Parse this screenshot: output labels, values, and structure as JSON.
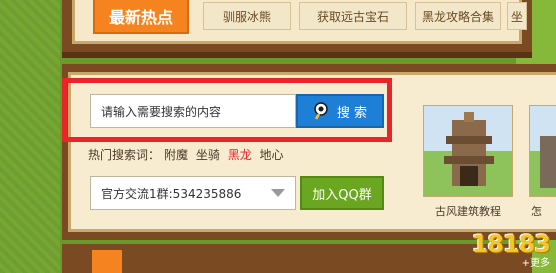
{
  "top_bar": {
    "badge": "最新热点",
    "tabs": [
      "驯服冰熊",
      "获取远古宝石",
      "黑龙攻略合集",
      "坐"
    ]
  },
  "search": {
    "placeholder": "请输入需要搜索的内容",
    "button_label": "搜 索"
  },
  "hot_words": {
    "label": "热门搜索词：",
    "items": [
      "附魔",
      "坐骑",
      "黑龙",
      "地心"
    ],
    "highlight_color": "#e8262a"
  },
  "qq_group": {
    "selected": "官方交流1群:534235886",
    "button_label": "加入QQ群"
  },
  "thumbnails": [
    {
      "caption": "古风建筑教程"
    },
    {
      "caption": "怎"
    }
  ],
  "watermark": {
    "logo": "18183",
    "more": "+更多"
  },
  "colors": {
    "accent_orange": "#f5831f",
    "search_blue": "#1e7fd6",
    "qq_green": "#6aa61f",
    "alert_red": "#e8262a"
  }
}
